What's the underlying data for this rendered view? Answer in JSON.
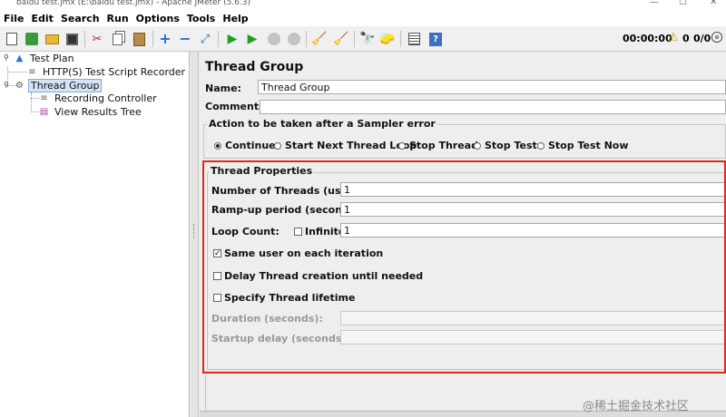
{
  "window": {
    "title": "baidu test.jmx (E:\\baidu test.jmx) - Apache JMeter (5.6.3)",
    "minimize": "—",
    "maximize": "☐",
    "close": "✕"
  },
  "menu": [
    "File",
    "Edit",
    "Search",
    "Run",
    "Options",
    "Tools",
    "Help"
  ],
  "toolbar": {
    "icons": [
      "new-icon",
      "templates-icon",
      "open-icon",
      "save-icon",
      "cut-icon",
      "copy-icon",
      "paste-icon",
      "expand-icon",
      "collapse-icon",
      "toggle-icon",
      "start-icon",
      "start-no-pause-icon",
      "stop-icon",
      "shutdown-icon",
      "clear-icon",
      "clear-all-icon",
      "search-icon",
      "reset-search-icon",
      "function-helper-icon",
      "help-icon"
    ],
    "timer": "00:00:00",
    "warnings": "0",
    "threads": "0/0"
  },
  "tree": {
    "items": [
      {
        "label": "Test Plan"
      },
      {
        "label": "HTTP(S) Test Script Recorder"
      },
      {
        "label": "Thread Group"
      },
      {
        "label": "Recording Controller"
      },
      {
        "label": "View Results Tree"
      }
    ]
  },
  "panel": {
    "title": "Thread Group",
    "name_label": "Name:",
    "name_value": "Thread Group",
    "comments_label": "Comments:",
    "comments_value": "",
    "error_action": {
      "title": "Action to be taken after a Sampler error",
      "options": [
        "Continue",
        "Start Next Thread Loop",
        "Stop Thread",
        "Stop Test",
        "Stop Test Now"
      ],
      "selected": "Continue"
    },
    "thread_props": {
      "title": "Thread Properties",
      "threads_label": "Number of Threads (users):",
      "threads_value": "1",
      "rampup_label": "Ramp-up period (seconds):",
      "rampup_value": "1",
      "loop_label": "Loop Count:",
      "infinite_label": "Infinite",
      "loop_value": "1",
      "same_user_label": "Same user on each iteration",
      "same_user_checked": true,
      "delay_label": "Delay Thread creation until needed",
      "lifetime_label": "Specify Thread lifetime",
      "duration_label": "Duration (seconds):",
      "startup_label": "Startup delay (seconds):"
    }
  },
  "watermark": "@稀土掘金技术社区",
  "colors": {
    "highlight": "#e0281f",
    "selection": "#d5e3f6"
  }
}
